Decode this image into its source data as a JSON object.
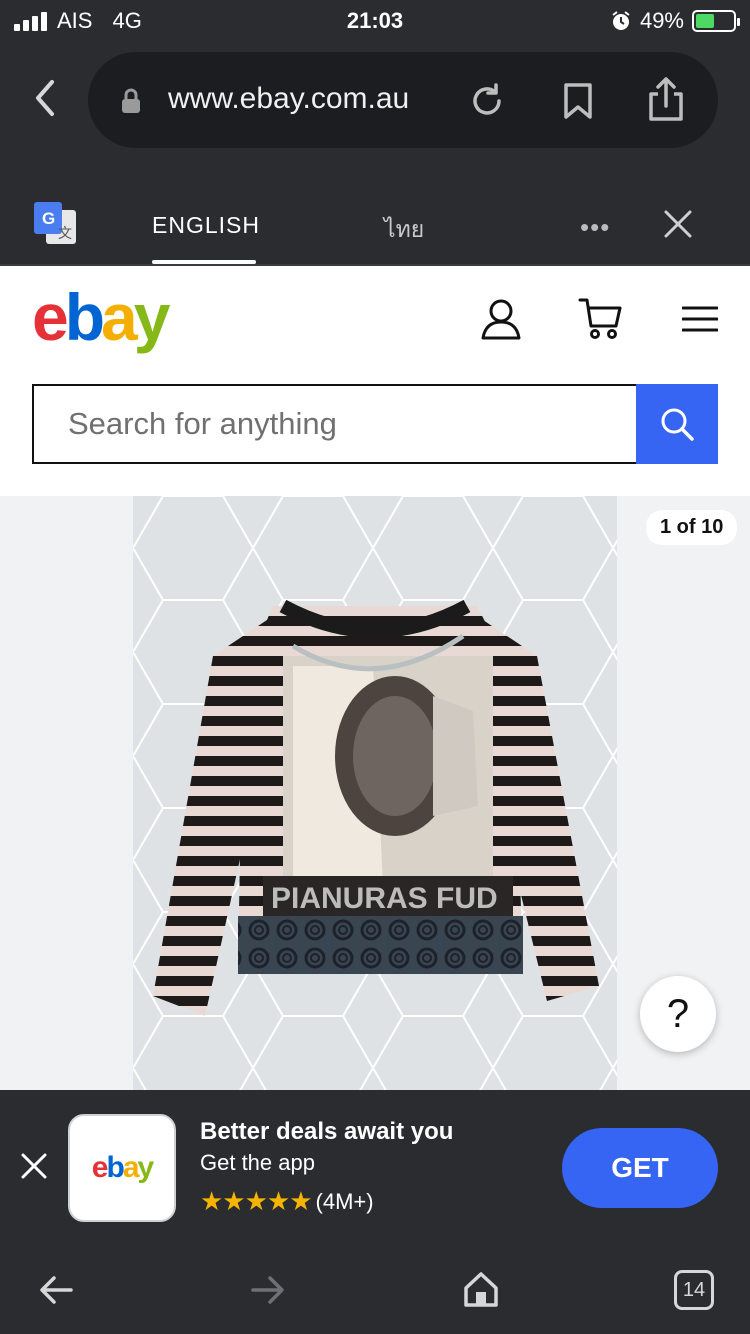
{
  "status_bar": {
    "carrier": "AIS",
    "network": "4G",
    "time": "21:03",
    "battery": "49%",
    "battery_level": 0.49
  },
  "browser": {
    "url": "www.ebay.com.au",
    "icons": [
      "back-chevron-icon",
      "lock-icon",
      "reload-icon",
      "bookmark-icon",
      "share-icon"
    ]
  },
  "translate_bar": {
    "tab_english": "ENGLISH",
    "tab_thai": "ไทย",
    "more": "•••"
  },
  "ebay": {
    "logo_letters": [
      "e",
      "b",
      "a",
      "y"
    ],
    "logo_colors": [
      "#e53238",
      "#0064d2",
      "#f5af02",
      "#86b817"
    ],
    "search_placeholder": "Search for anything",
    "accent": "#3665f3"
  },
  "gallery": {
    "counter": "1 of 10",
    "help": "?"
  },
  "app_banner": {
    "app_logo_letters": [
      "e",
      "b",
      "a",
      "y"
    ],
    "title": "Better deals await you",
    "subtitle": "Get the app",
    "stars": "★★★★★",
    "rating_count": "(4M+)",
    "get": "GET"
  },
  "toolbar": {
    "tabs_count": "14"
  }
}
